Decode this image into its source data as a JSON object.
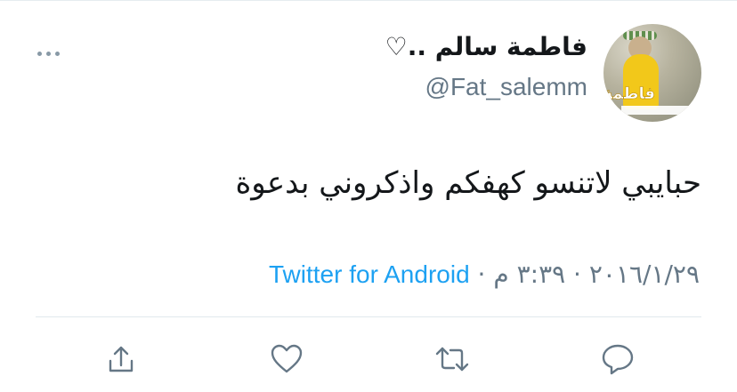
{
  "tweet": {
    "display_name": "فاطمة سالم ..♡",
    "username": "@Fat_salemm",
    "text": "حبايبي لاتنسو كهفكم واذكروني بدعوة",
    "date": "٢٠١٦/١/٢٩",
    "separator": " · ",
    "time": "٣:٣٩ م",
    "source": "Twitter for Android"
  },
  "avatar": {
    "label_text": "فاطمة"
  },
  "actions": {
    "icons": [
      "share-icon",
      "like-icon",
      "retweet-icon",
      "reply-icon"
    ]
  },
  "colors": {
    "text": "#14171a",
    "secondary": "#657786",
    "link": "#1da1f2",
    "icon": "#657786",
    "divider": "#e1e8ed"
  }
}
